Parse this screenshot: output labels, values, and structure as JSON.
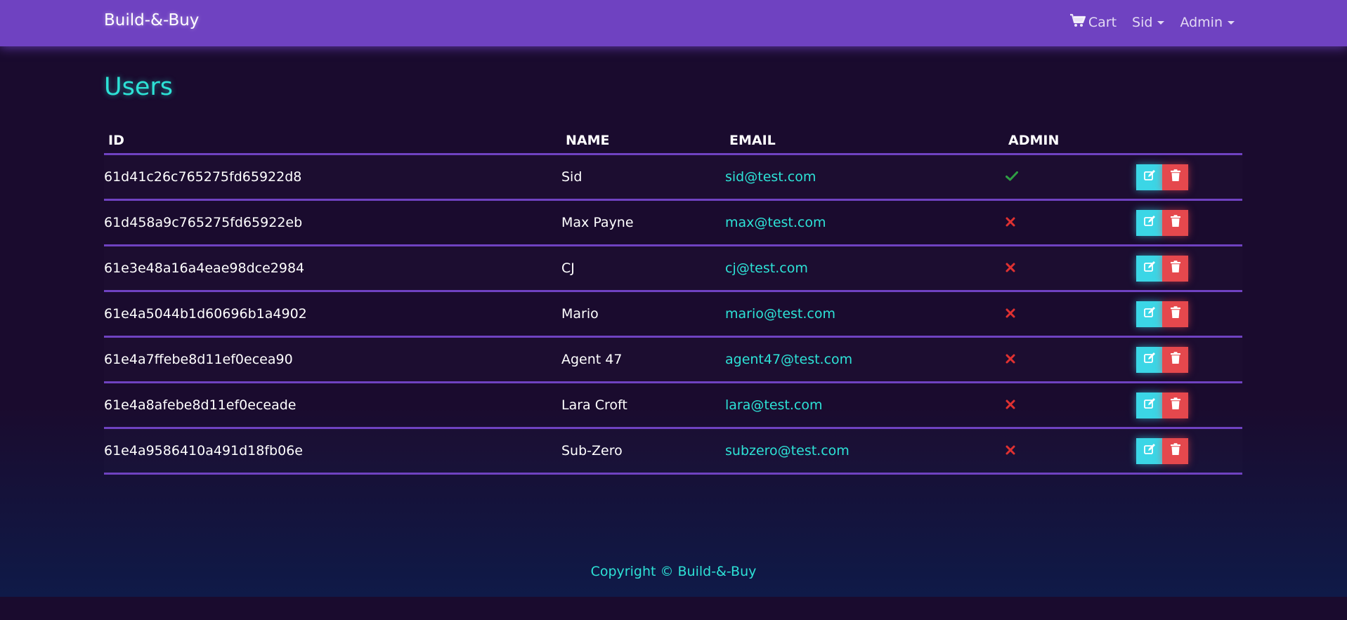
{
  "header": {
    "brand": "Build-&-Buy",
    "cart_label": "Cart",
    "user_menu_label": "Sid",
    "admin_menu_label": "Admin"
  },
  "page": {
    "title": "Users"
  },
  "table": {
    "columns": [
      "ID",
      "NAME",
      "EMAIL",
      "ADMIN"
    ],
    "rows": [
      {
        "id": "61d41c26c765275fd65922d8",
        "name": "Sid",
        "email": "sid@test.com",
        "admin": true
      },
      {
        "id": "61d458a9c765275fd65922eb",
        "name": "Max Payne",
        "email": "max@test.com",
        "admin": false
      },
      {
        "id": "61e3e48a16a4eae98dce2984",
        "name": "CJ",
        "email": "cj@test.com",
        "admin": false
      },
      {
        "id": "61e4a5044b1d60696b1a4902",
        "name": "Mario",
        "email": "mario@test.com",
        "admin": false
      },
      {
        "id": "61e4a7ffebe8d11ef0ecea90",
        "name": "Agent 47",
        "email": "agent47@test.com",
        "admin": false
      },
      {
        "id": "61e4a8afebe8d11ef0eceade",
        "name": "Lara Croft",
        "email": "lara@test.com",
        "admin": false
      },
      {
        "id": "61e4a9586410a491d18fb06e",
        "name": "Sub-Zero",
        "email": "subzero@test.com",
        "admin": false
      }
    ]
  },
  "footer": {
    "copyright": "Copyright © Build-&-Buy"
  },
  "colors": {
    "navbar": "#6f42c1",
    "accent": "#2de2d6",
    "edit_button": "#3bd6e6",
    "delete_button": "#e5484d",
    "admin_yes": "#2f9e44",
    "admin_no": "#e03131"
  },
  "icons": {
    "cart": "shopping-cart-icon",
    "admin_yes": "check-icon",
    "admin_no": "times-icon",
    "edit": "edit-icon",
    "delete": "trash-icon"
  }
}
